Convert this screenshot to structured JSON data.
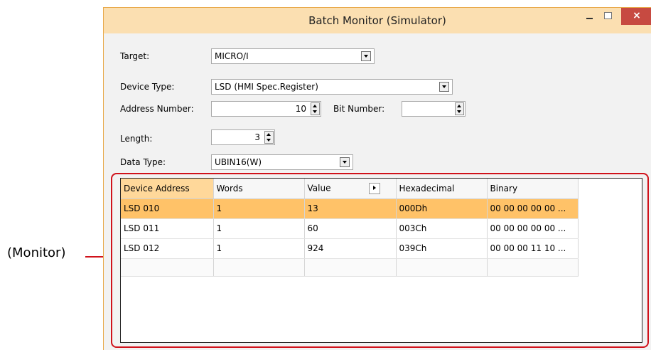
{
  "callout": {
    "label": "(Monitor)"
  },
  "window": {
    "title": "Batch Monitor (Simulator)",
    "minimize_icon": "minimize-icon",
    "maximize_icon": "maximize-icon",
    "close_icon": "close-icon",
    "close_glyph": "×"
  },
  "form": {
    "target_label": "Target:",
    "target_value": "MICRO/I",
    "device_type_label": "Device Type:",
    "device_type_value": "LSD (HMI Spec.Register)",
    "address_label": "Address Number:",
    "address_value": "10",
    "bit_label": "Bit Number:",
    "bit_value": "",
    "length_label": "Length:",
    "length_value": "3",
    "data_type_label": "Data Type:",
    "data_type_value": "UBIN16(W)"
  },
  "grid": {
    "columns": [
      "Device Address",
      "Words",
      "Value",
      "Hexadecimal",
      "Binary"
    ],
    "rows": [
      [
        "LSD 010",
        "1",
        "13",
        "000Dh",
        "00 00 00 00 00 ..."
      ],
      [
        "LSD 011",
        "1",
        "60",
        "003Ch",
        "00 00 00 00 00 ..."
      ],
      [
        "LSD 012",
        "1",
        "924",
        "039Ch",
        "00 00 00 11 10 ..."
      ]
    ],
    "selected_row": 0,
    "colors": {
      "selected": "#ffc268",
      "outline": "#d0121b",
      "title_bar": "#fbdfb1"
    }
  }
}
